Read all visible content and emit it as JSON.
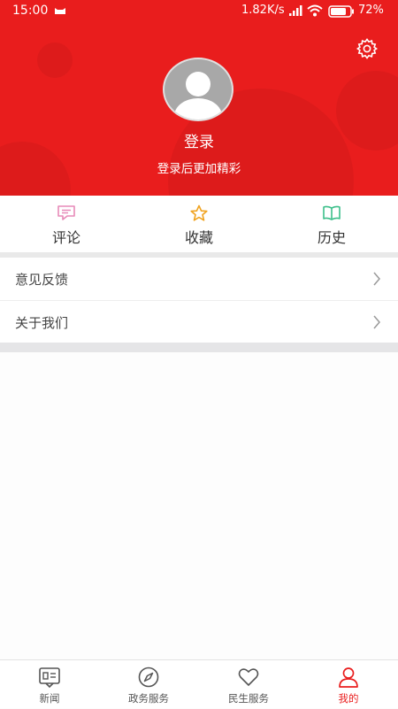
{
  "status_bar": {
    "time": "15:00",
    "network_speed": "1.82K/s",
    "battery": "72%"
  },
  "profile": {
    "login_label": "登录",
    "login_subtitle": "登录后更加精彩"
  },
  "quick_actions": [
    {
      "label": "评论",
      "icon": "comment-icon",
      "color": "#e78ab8"
    },
    {
      "label": "收藏",
      "icon": "star-icon",
      "color": "#f0a21e"
    },
    {
      "label": "历史",
      "icon": "book-icon",
      "color": "#3cbf8a"
    }
  ],
  "menu": [
    {
      "label": "意见反馈"
    },
    {
      "label": "关于我们"
    }
  ],
  "tabbar": {
    "items": [
      {
        "label": "新闻",
        "icon": "news-icon"
      },
      {
        "label": "政务服务",
        "icon": "compass-icon"
      },
      {
        "label": "民生服务",
        "icon": "heart-icon"
      },
      {
        "label": "我的",
        "icon": "person-icon"
      }
    ],
    "active": "我的"
  },
  "colors": {
    "header_red": "#e91d1d",
    "accent": "#e91d1d",
    "background": "#fdfdfd"
  }
}
